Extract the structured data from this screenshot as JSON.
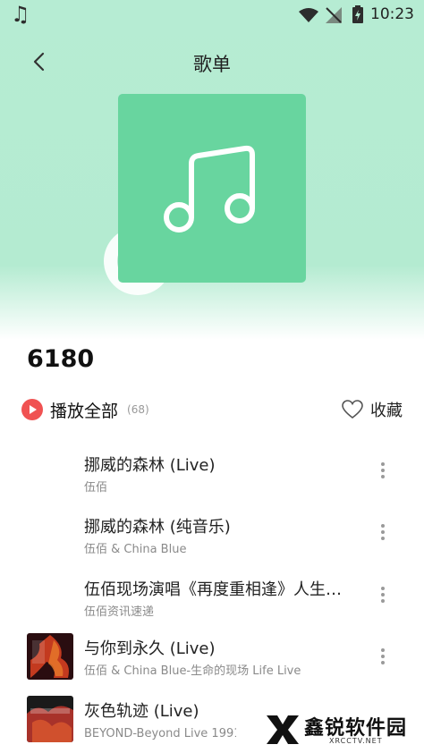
{
  "status_bar": {
    "time": "10:23",
    "music_glyph": "♫",
    "icons": [
      "music-note-icon",
      "wifi-icon",
      "no-signal-icon",
      "battery-charging-icon"
    ]
  },
  "header": {
    "title": "歌单",
    "back_icon": "chevron-left-icon"
  },
  "playlist": {
    "name": "6180",
    "cover_color": "#68d59f",
    "cover_icon": "music-note-icon"
  },
  "actions": {
    "play_all_label": "播放全部",
    "play_all_count": "(68)",
    "favorite_label": "收藏",
    "play_color": "#f05252"
  },
  "songs": [
    {
      "title": "挪威的森林 (Live)",
      "subtitle": "伍佰",
      "has_cover": false
    },
    {
      "title": "挪威的森林 (纯音乐)",
      "subtitle": "伍佰 & China Blue",
      "has_cover": false
    },
    {
      "title": "伍佰现场演唱《再度重相逢》人生…",
      "subtitle": "伍佰资讯速递",
      "has_cover": false
    },
    {
      "title": "与你到永久 (Live)",
      "subtitle": "伍佰 & China Blue-生命的现场 Life Live",
      "has_cover": true
    },
    {
      "title": "灰色轨迹 (Live)",
      "subtitle": "BEYOND-Beyond Live 1991 生",
      "has_cover": true
    }
  ],
  "watermark": {
    "text": "鑫锐软件园",
    "subtext": "XRCCTV.NET"
  }
}
